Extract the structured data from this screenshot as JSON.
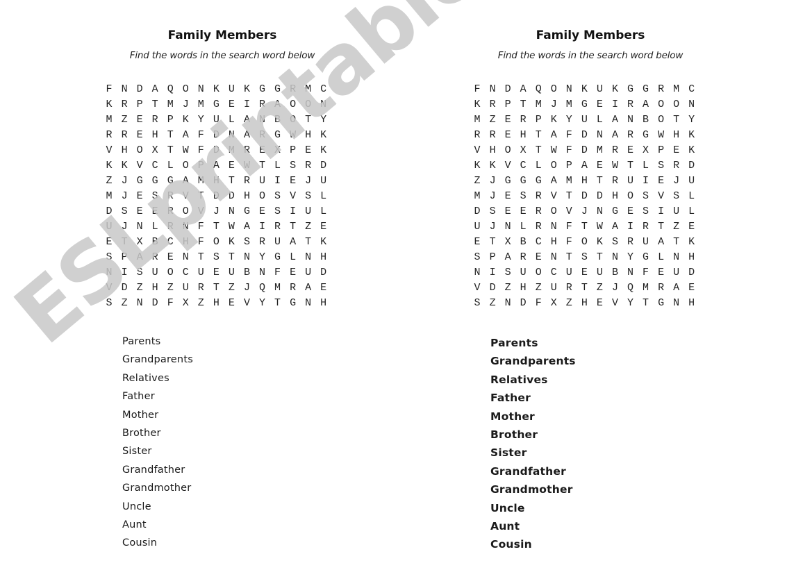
{
  "worksheet": {
    "title": "Family Members",
    "subtitle": "Find the words in the search word below",
    "grid": [
      "FNDAQONKUKGGRMC",
      "KRPTMJMGEIRAOON",
      "MZERPKYULANBOTY",
      "RREHTAFDNARGWHK",
      "VHOXTWFDMREXPEK",
      "KKVCLOPAEWTLSRD",
      "ZJGGGAMHTRUIEJU",
      "MJESRVTDDHOSVSL",
      "DSEEROVJNGESIUL",
      "UJNLRNFTWAIRTZE",
      "ETXBCHFOKSRUATK",
      "SPARENTSTNYGLNH",
      "NISUOCUEUBNFEUD",
      "VDZHZURTZJQMRAE",
      "SZNDFXZHEVYTGNH"
    ],
    "words": [
      "Parents",
      "Grandparents",
      "Relatives",
      "Father",
      "Mother",
      "Brother",
      "Sister",
      "Grandfather",
      "Grandmother",
      "Uncle",
      "Aunt",
      "Cousin"
    ]
  },
  "watermark": "ESLprintables.com"
}
